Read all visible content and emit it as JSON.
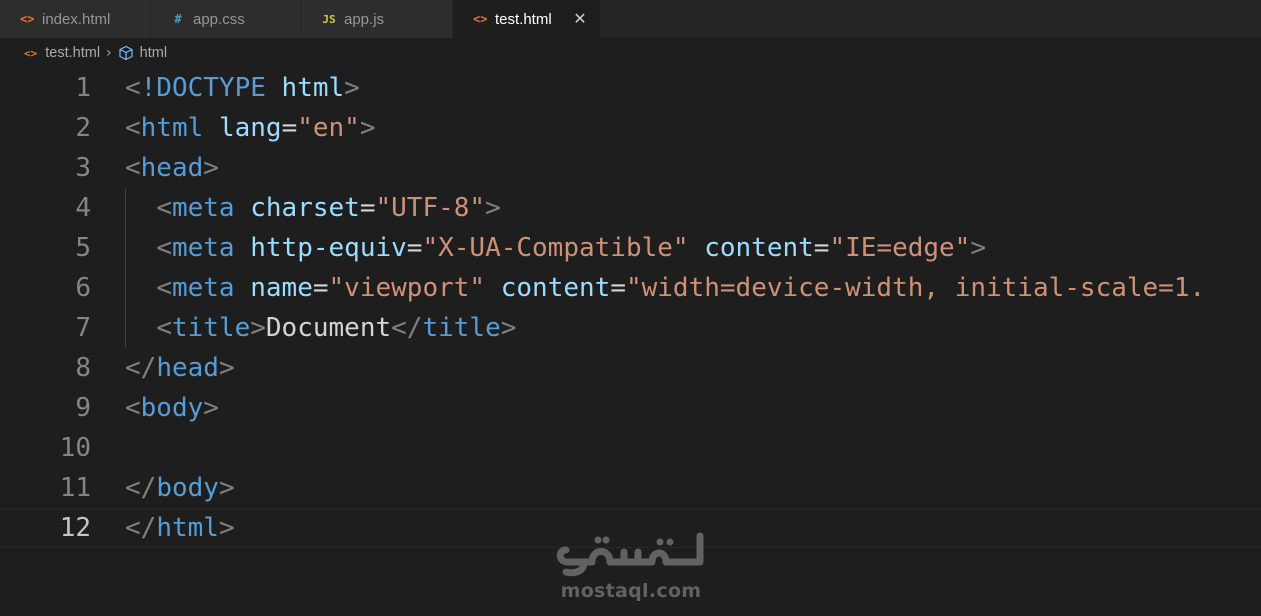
{
  "tabs": [
    {
      "label": "index.html",
      "icon": "<>",
      "icon_color": "#e37933",
      "active": false
    },
    {
      "label": "app.css",
      "icon": "#",
      "icon_color": "#519aba",
      "active": false
    },
    {
      "label": "app.js",
      "icon": "JS",
      "icon_color": "#cbcb41",
      "active": false
    },
    {
      "label": "test.html",
      "icon": "<>",
      "icon_color": "#e37933",
      "active": true,
      "close": "✕"
    }
  ],
  "breadcrumb": {
    "file_icon": "<>",
    "file": "test.html",
    "separator": "›",
    "symbol": "html",
    "symbol_icon": "cube-icon"
  },
  "editor": {
    "current_line": 12,
    "lines": [
      {
        "n": "1"
      },
      {
        "n": "2"
      },
      {
        "n": "3"
      },
      {
        "n": "4"
      },
      {
        "n": "5"
      },
      {
        "n": "6"
      },
      {
        "n": "7"
      },
      {
        "n": "8"
      },
      {
        "n": "9"
      },
      {
        "n": "10"
      },
      {
        "n": "11"
      },
      {
        "n": "12"
      }
    ],
    "code": {
      "l1": {
        "open": "<",
        "doctype": "!DOCTYPE",
        "name": "html",
        "close": ">"
      },
      "l2": {
        "open": "<",
        "tag": "html",
        "attr": "lang",
        "eq": "=",
        "val": "\"en\"",
        "close": ">"
      },
      "l3": {
        "open": "<",
        "tag": "head",
        "close": ">"
      },
      "l4": {
        "open": "<",
        "tag": "meta",
        "attr": "charset",
        "eq": "=",
        "val": "\"UTF-8\"",
        "close": ">"
      },
      "l5": {
        "open": "<",
        "tag": "meta",
        "attr1": "http-equiv",
        "eq1": "=",
        "val1": "\"X-UA-Compatible\"",
        "attr2": "content",
        "eq2": "=",
        "val2": "\"IE=edge\"",
        "close": ">"
      },
      "l6": {
        "open": "<",
        "tag": "meta",
        "attr1": "name",
        "eq1": "=",
        "val1": "\"viewport\"",
        "attr2": "content",
        "eq2": "=",
        "val2": "\"width=device-width, initial-scale=1."
      },
      "l7": {
        "open": "<",
        "tag": "title",
        "close": ">",
        "text": "Document",
        "open2": "</",
        "tag2": "title",
        "close2": ">"
      },
      "l8": {
        "open": "</",
        "tag": "head",
        "close": ">"
      },
      "l9": {
        "open": "<",
        "tag": "body",
        "close": ">"
      },
      "l11": {
        "open": "</",
        "tag": "body",
        "close": ">"
      },
      "l12": {
        "open": "</",
        "tag": "html",
        "close": ">"
      }
    }
  },
  "watermark": {
    "brand_logo": "مستقل",
    "subtitle": "mostaql.com"
  },
  "colors": {
    "tag": "#569cd6",
    "attr": "#9cdcfe",
    "string": "#ce9178",
    "punct": "#808080",
    "text": "#d4d4d4",
    "line_number": "#858585"
  }
}
